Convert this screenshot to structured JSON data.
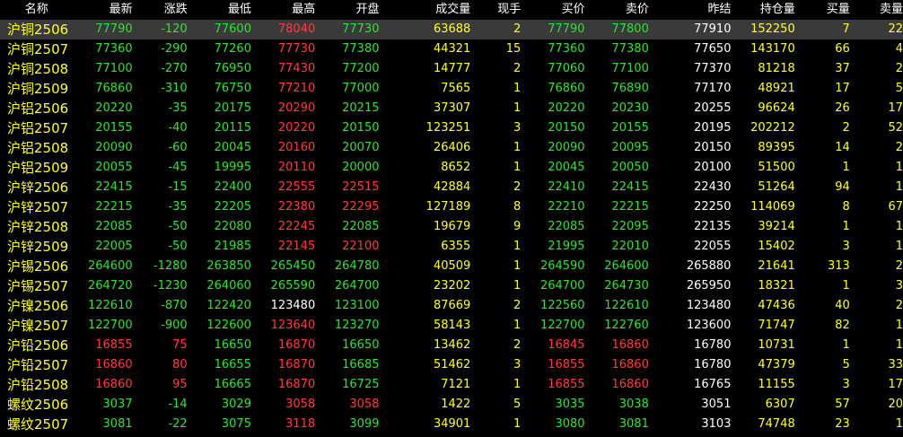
{
  "colors": {
    "background": "#000000",
    "header_text": "#ffffff",
    "name_text": "#ffff33",
    "up": "#ff3c3c",
    "down": "#33e033",
    "flat": "#ffffff",
    "volume": "#ffff33",
    "selected_row": "#3a3a3a"
  },
  "columns": [
    "名称",
    "最新",
    "涨跌",
    "最低",
    "最高",
    "开盘",
    "成交量",
    "现手",
    "买价",
    "卖价",
    "昨结",
    "持仓量",
    "买量",
    "卖量"
  ],
  "rows": [
    [
      "沪铜2506",
      "77790",
      "-120",
      "77600",
      "78040",
      "77730",
      "63688",
      "2",
      "77790",
      "77800",
      "77910",
      "152250",
      "7",
      "22"
    ],
    [
      "沪铜2507",
      "77360",
      "-290",
      "77260",
      "77730",
      "77380",
      "44321",
      "15",
      "77360",
      "77380",
      "77650",
      "143170",
      "66",
      "4"
    ],
    [
      "沪铜2508",
      "77100",
      "-270",
      "76950",
      "77430",
      "77200",
      "14777",
      "2",
      "77060",
      "77100",
      "77370",
      "81218",
      "37",
      "2"
    ],
    [
      "沪铜2509",
      "76860",
      "-310",
      "76750",
      "77210",
      "77000",
      "7565",
      "1",
      "76860",
      "76890",
      "77170",
      "48921",
      "17",
      "5"
    ],
    [
      "沪铝2506",
      "20220",
      "-35",
      "20175",
      "20290",
      "20215",
      "37307",
      "1",
      "20220",
      "20230",
      "20255",
      "96624",
      "26",
      "17"
    ],
    [
      "沪铝2507",
      "20155",
      "-40",
      "20115",
      "20220",
      "20150",
      "123251",
      "3",
      "20150",
      "20155",
      "20195",
      "202212",
      "2",
      "52"
    ],
    [
      "沪铝2508",
      "20090",
      "-60",
      "20045",
      "20160",
      "20070",
      "26406",
      "1",
      "20090",
      "20095",
      "20150",
      "89395",
      "14",
      "2"
    ],
    [
      "沪铝2509",
      "20055",
      "-45",
      "19995",
      "20110",
      "20000",
      "8652",
      "1",
      "20045",
      "20050",
      "20100",
      "51500",
      "1",
      "1"
    ],
    [
      "沪锌2506",
      "22415",
      "-15",
      "22400",
      "22555",
      "22515",
      "42884",
      "2",
      "22410",
      "22415",
      "22430",
      "51264",
      "94",
      "1"
    ],
    [
      "沪锌2507",
      "22215",
      "-35",
      "22205",
      "22380",
      "22295",
      "127189",
      "8",
      "22210",
      "22215",
      "22250",
      "114069",
      "8",
      "67"
    ],
    [
      "沪锌2508",
      "22085",
      "-50",
      "22080",
      "22245",
      "22085",
      "19679",
      "9",
      "22085",
      "22095",
      "22135",
      "39214",
      "1",
      "1"
    ],
    [
      "沪锌2509",
      "22005",
      "-50",
      "21985",
      "22145",
      "22100",
      "6355",
      "1",
      "21995",
      "22010",
      "22055",
      "15402",
      "3",
      "1"
    ],
    [
      "沪锡2506",
      "264600",
      "-1280",
      "263850",
      "265450",
      "264780",
      "40509",
      "1",
      "264590",
      "264600",
      "265880",
      "21641",
      "313",
      "2"
    ],
    [
      "沪锡2507",
      "264720",
      "-1230",
      "264060",
      "265590",
      "264700",
      "23202",
      "1",
      "264700",
      "264730",
      "265950",
      "18321",
      "1",
      "3"
    ],
    [
      "沪镍2506",
      "122610",
      "-870",
      "122420",
      "123480",
      "123100",
      "87669",
      "2",
      "122560",
      "122610",
      "123480",
      "47436",
      "40",
      "2"
    ],
    [
      "沪镍2507",
      "122700",
      "-900",
      "122600",
      "123640",
      "123270",
      "58143",
      "1",
      "122700",
      "122760",
      "123600",
      "71747",
      "82",
      "1"
    ],
    [
      "沪铅2506",
      "16855",
      "75",
      "16650",
      "16870",
      "16650",
      "13462",
      "2",
      "16845",
      "16860",
      "16780",
      "10731",
      "1",
      "1"
    ],
    [
      "沪铅2507",
      "16860",
      "80",
      "16655",
      "16870",
      "16685",
      "51462",
      "3",
      "16855",
      "16860",
      "16780",
      "47379",
      "5",
      "33"
    ],
    [
      "沪铅2508",
      "16860",
      "95",
      "16665",
      "16870",
      "16725",
      "7121",
      "1",
      "16855",
      "16860",
      "16765",
      "11155",
      "3",
      "17"
    ],
    [
      "螺纹2506",
      "3037",
      "-14",
      "3029",
      "3058",
      "3058",
      "1422",
      "5",
      "3035",
      "3038",
      "3051",
      "6307",
      "57",
      "20"
    ],
    [
      "螺纹2507",
      "3081",
      "-22",
      "3075",
      "3118",
      "3099",
      "34901",
      "1",
      "3080",
      "3081",
      "3103",
      "74748",
      "23",
      "1"
    ]
  ],
  "selected_row": 0
}
